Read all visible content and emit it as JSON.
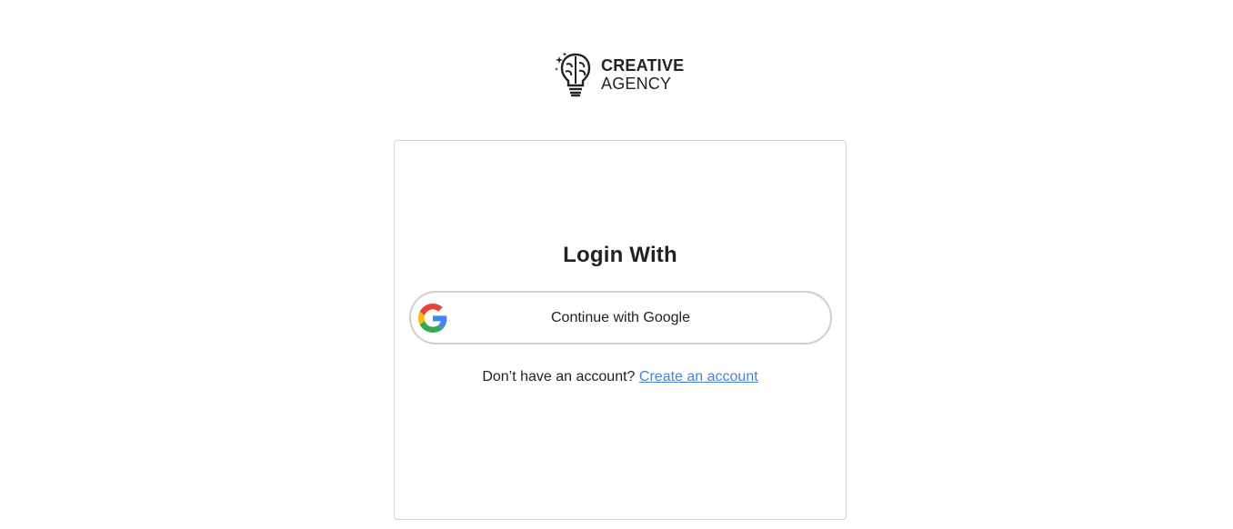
{
  "brand": {
    "line1": "CREATIVE",
    "line2": "AGENCY",
    "logo_icon": "brain-lightbulb-icon"
  },
  "login": {
    "title": "Login With",
    "google_button_label": "Continue with Google",
    "google_icon": "google-icon",
    "signup_prompt": "Don’t have an account?",
    "signup_link": "Create an account"
  },
  "colors": {
    "link": "#4a7fd6",
    "text": "#222222",
    "border": "#cfcfcf"
  }
}
